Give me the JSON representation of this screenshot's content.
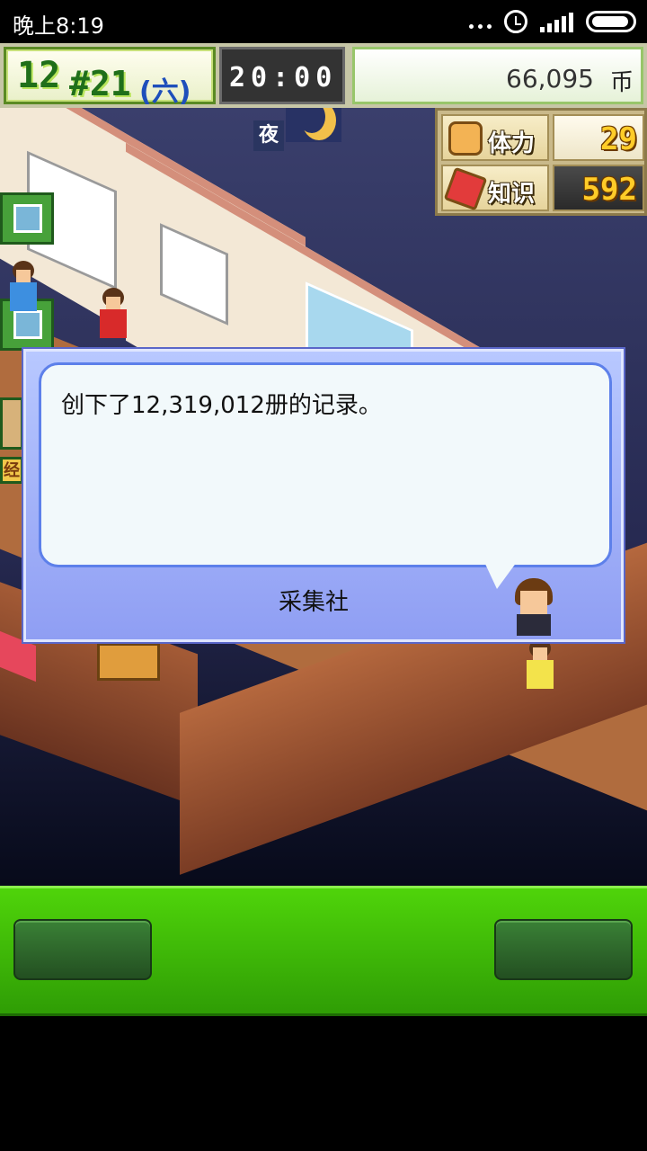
{
  "status_bar": {
    "time": "晚上8:19",
    "icons": [
      "more-dots-icon",
      "alarm-icon",
      "signal-icon",
      "battery-icon"
    ]
  },
  "hud": {
    "month": "12",
    "day": "#21",
    "weekday": "(六)",
    "clock": "20:00",
    "money": "66,095",
    "money_unit": "币"
  },
  "scene": {
    "night_label": "夜",
    "side_label": "经"
  },
  "stats": {
    "stamina_label": "体力",
    "stamina_value": "29",
    "knowledge_label": "知识",
    "knowledge_value": "592"
  },
  "dialog": {
    "message": "创下了12,319,012册的记录。",
    "speaker": "采集社"
  },
  "bottom_bar": {
    "left_button_label": "",
    "right_button_label": ""
  },
  "colors": {
    "bottom_bar_green": "#4fd40a",
    "dialog_blue": "#8f9ef3",
    "stat_gold": "#ffcc28"
  }
}
